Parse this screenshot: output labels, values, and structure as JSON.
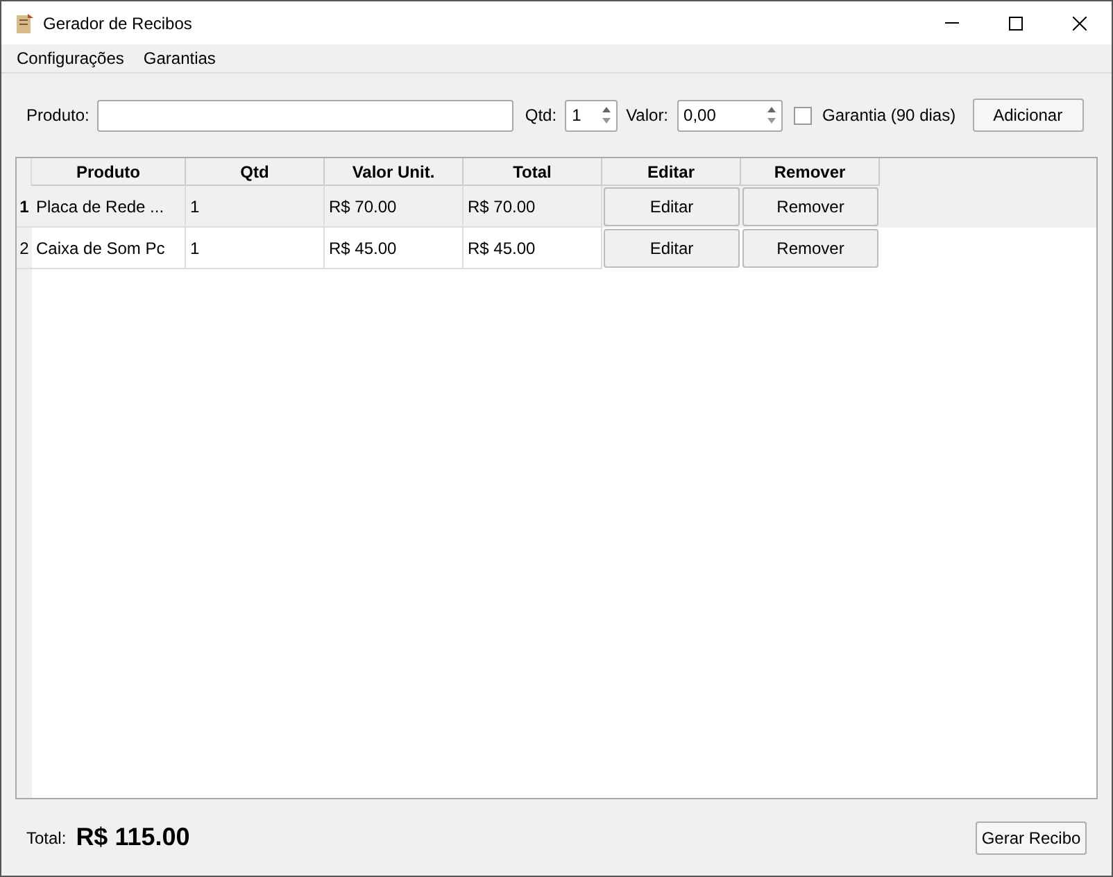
{
  "window": {
    "title": "Gerador de Recibos"
  },
  "menu": [
    "Configurações",
    "Garantias"
  ],
  "form": {
    "product_label": "Produto:",
    "qty_label": "Qtd:",
    "qty_value": "1",
    "value_label": "Valor:",
    "value_value": "0,00",
    "warranty": {
      "label": "Garantia (90 dias)",
      "checked": false
    },
    "add_button": "Adicionar"
  },
  "table": {
    "columns": [
      "Produto",
      "Qtd",
      "Valor Unit.",
      "Total",
      "Editar",
      "Remover"
    ],
    "rows": [
      {
        "number": "1",
        "selected": true,
        "product": "Placa de Rede ...",
        "qty": "1",
        "unit": "R$ 70.00",
        "total": "R$ 70.00",
        "edit": "Editar",
        "remove": "Remover"
      },
      {
        "number": "2",
        "selected": false,
        "product": "Caixa de Som Pc",
        "qty": "1",
        "unit": "R$ 45.00",
        "total": "R$ 45.00",
        "edit": "Editar",
        "remove": "Remover"
      }
    ]
  },
  "footer": {
    "total_label": "Total:",
    "total_value": "R$ 115.00",
    "generate_button": "Gerar Recibo"
  }
}
